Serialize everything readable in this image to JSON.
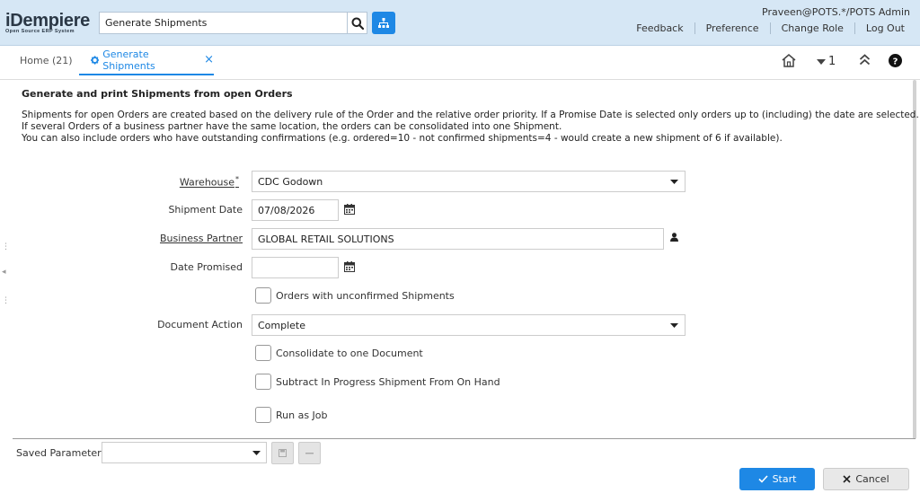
{
  "header": {
    "logo_main": "iDempiere",
    "logo_sub": "Open Source ERP System",
    "search_value": "Generate Shipments",
    "user": "Praveen@POTS.*/POTS Admin",
    "links": [
      "Feedback",
      "Preference",
      "Change Role",
      "Log Out"
    ]
  },
  "tabs": {
    "home": "Home (21)",
    "active": "Generate Shipments",
    "close": "×"
  },
  "toolbar": {
    "count": "1"
  },
  "process": {
    "title": "Generate and print Shipments from open Orders",
    "description": [
      "Shipments for open Orders are created based on the delivery rule of the Order and the relative order priority. If a Promise Date is selected only orders up to (including) the date are selected.",
      "If several Orders of a business partner have the same location, the orders can be consolidated into one Shipment.",
      "You can also include orders who have outstanding confirmations (e.g. ordered=10 - not confirmed shipments=4 - would create a new shipment of 6 if available)."
    ]
  },
  "params": {
    "warehouse_label": "Warehouse",
    "warehouse_mandatory": "*",
    "warehouse_value": "CDC Godown",
    "shipment_date_label": "Shipment Date",
    "shipment_date_value": "07/08/2026",
    "bpartner_label": "Business Partner",
    "bpartner_value": "GLOBAL RETAIL SOLUTIONS",
    "date_promised_label": "Date Promised",
    "date_promised_value": "",
    "unconfirmed_label": "Orders with unconfirmed Shipments",
    "doc_action_label": "Document Action",
    "doc_action_value": "Complete",
    "consolidate_label": "Consolidate to one Document",
    "subtract_label": "Subtract In Progress Shipment From On Hand",
    "run_job_label": "Run as Job"
  },
  "footer": {
    "saved_params_label": "Saved Parameters",
    "saved_params_value": "",
    "start_label": "Start",
    "cancel_label": "Cancel"
  },
  "colors": {
    "header_bg": "#d6e7f5",
    "accent": "#1e88e5"
  }
}
